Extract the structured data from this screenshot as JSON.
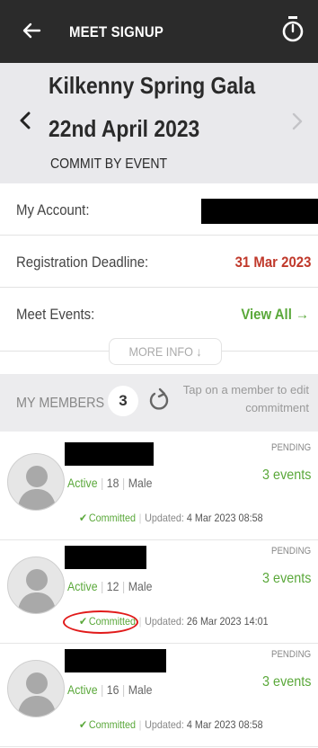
{
  "header": {
    "title": "MEET SIGNUP"
  },
  "event": {
    "name": "Kilkenny Spring Gala",
    "date": "22nd April 2023",
    "commit_mode": "COMMIT BY EVENT"
  },
  "info": {
    "account_label": "My Account:",
    "deadline_label": "Registration Deadline:",
    "deadline_value": "31 Mar 2023",
    "events_label": "Meet Events:",
    "events_link": "View All →",
    "more_info": "MORE INFO ↓"
  },
  "members": {
    "title": "MY MEMBERS",
    "count": "3",
    "hint": "Tap on a member to edit commitment",
    "list": [
      {
        "status": "Active",
        "age": "18",
        "gender": "Male",
        "state": "PENDING",
        "events": "3 events",
        "commit": "Committed",
        "updated_label": "Updated:",
        "updated": "4 Mar 2023 08:58"
      },
      {
        "status": "Active",
        "age": "12",
        "gender": "Male",
        "state": "PENDING",
        "events": "3 events",
        "commit": "Committed",
        "updated_label": "Updated:",
        "updated": "26 Mar 2023 14:01"
      },
      {
        "status": "Active",
        "age": "16",
        "gender": "Male",
        "state": "PENDING",
        "events": "3 events",
        "commit": "Committed",
        "updated_label": "Updated:",
        "updated": "4 Mar 2023 08:58"
      }
    ]
  },
  "colors": {
    "topbar": "#2b2b2b",
    "accent_green": "#5aa83a",
    "deadline_red": "#c0392b",
    "highlight_circle": "#e11a1a"
  },
  "icons": {
    "back": "arrow-left-icon",
    "timer": "stopwatch-icon",
    "prev": "chevron-left-icon",
    "next": "chevron-right-icon",
    "refresh": "refresh-icon",
    "avatar": "person-silhouette-icon"
  }
}
